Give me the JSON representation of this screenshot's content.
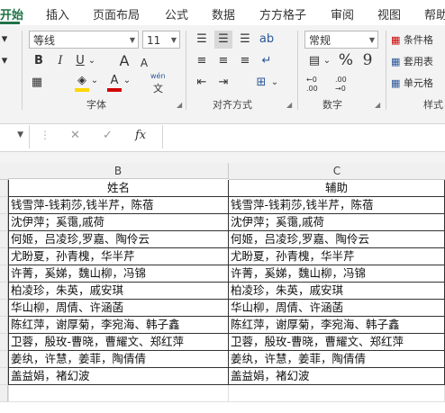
{
  "tabs": [
    "开始",
    "插入",
    "页面布局",
    "公式",
    "数据",
    "方方格子",
    "审阅",
    "视图",
    "帮助"
  ],
  "ribbon": {
    "font_name": "等线",
    "font_size": "11",
    "bold": "B",
    "italic": "I",
    "underline": "U",
    "underline_caret": "⌄",
    "font_color_caret": "⌄",
    "fill_caret": "⌄",
    "phonetic": "wén",
    "phonetic_sub": "文",
    "grow_font": "A",
    "shrink_font": "A",
    "group_font": "字体",
    "group_align": "对齐方式",
    "group_number": "数字",
    "number_format": "常规",
    "percent": "%",
    "comma": "9",
    "dec_inc": "←0 .00",
    "dec_dec": ".00 →0",
    "cond_format": "条件格",
    "table_format": "套用表",
    "cell_style": "单元格",
    "group_style": "样式",
    "font_color": "#d00000",
    "fill_color": "#ffd700",
    "accent": "#217346"
  },
  "formula_bar": {
    "fx": "fx",
    "cancel": "✕",
    "enter": "✓",
    "value": ""
  },
  "grid": {
    "col_headers": [
      "B",
      "C"
    ],
    "header_row": [
      "姓名",
      "辅助"
    ],
    "rows": [
      [
        "钱雪萍-钱莉莎,钱半芹，陈蓓",
        "钱雪萍-钱莉莎,钱半芹，陈蓓"
      ],
      [
        "沈伊萍；奚霭,戚荷",
        "沈伊萍；奚霭,戚荷"
      ],
      [
        "何姬，吕凌珍,罗嘉、陶伶云",
        "何姬，吕凌珍,罗嘉、陶伶云"
      ],
      [
        "尤盼夏，孙青槐，华半芹",
        "尤盼夏，孙青槐，华半芹"
      ],
      [
        "许菁，奚娣，魏山柳，冯锦",
        "许菁，奚娣，魏山柳，冯锦"
      ],
      [
        "柏凌珍，朱英，戚安琪",
        "柏凌珍，朱英，戚安琪"
      ],
      [
        "华山柳，周倩、许涵菡",
        "华山柳，周倩、许涵菡"
      ],
      [
        "陈红萍，谢厚菊，李宛海、韩子鑫",
        "陈红萍，谢厚菊，李宛海、韩子鑫"
      ],
      [
        "卫蓉，殷玫-曹晓，曹耀文、郑红萍",
        "卫蓉，殷玫-曹晓，曹耀文、郑红萍"
      ],
      [
        "姜纨，许慧，姜菲，陶倩倩",
        "姜纨，许慧，姜菲，陶倩倩"
      ],
      [
        "盖益娟，褚幻波",
        "盖益娟，褚幻波"
      ]
    ]
  }
}
